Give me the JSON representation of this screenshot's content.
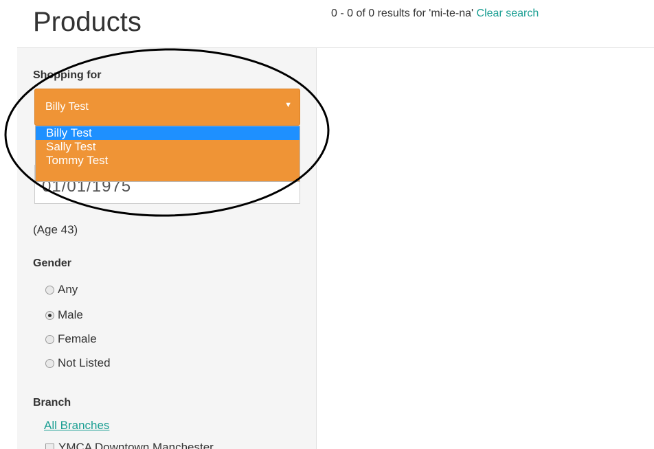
{
  "header": {
    "title": "Products",
    "results_summary": "0 - 0 of 0 results for 'mi-te-na'",
    "clear_search": "Clear search"
  },
  "shopping_for": {
    "label": "Shopping for",
    "selected": "Billy Test",
    "options": [
      "Billy Test",
      "Sally Test",
      "Tommy Test"
    ]
  },
  "dob": {
    "value": "01/01/1975"
  },
  "age": {
    "text": "(Age 43)"
  },
  "gender": {
    "label": "Gender",
    "options": [
      "Any",
      "Male",
      "Female",
      "Not Listed"
    ],
    "selected": "Male"
  },
  "branch": {
    "label": "Branch",
    "all_link": "All Branches",
    "first_item": "YMCA Downtown Manchester"
  },
  "colors": {
    "accent_orange": "#ef9436",
    "link_teal": "#1a9e92",
    "highlight_blue": "#1e90ff"
  }
}
